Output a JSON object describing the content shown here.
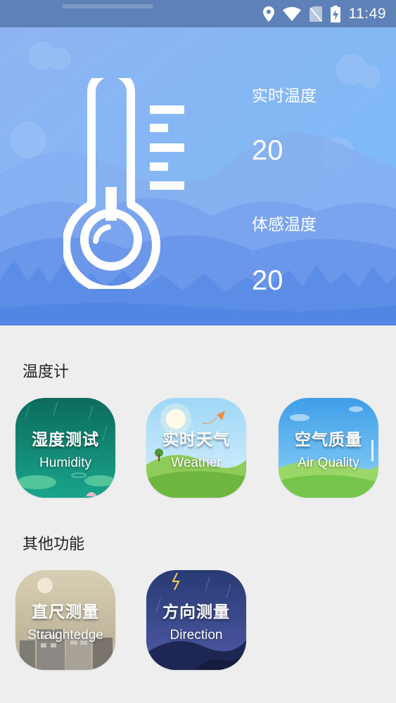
{
  "status_bar": {
    "time": "11:49",
    "icons": [
      "location-icon",
      "wifi-icon",
      "no-sim-icon",
      "battery-charging-icon"
    ]
  },
  "hero": {
    "realtime_temp_label": "实时温度",
    "realtime_temp_value": "20",
    "feels_like_label": "体感温度",
    "feels_like_value": "20"
  },
  "sections": {
    "thermometer_title": "温度计",
    "other_title": "其他功能"
  },
  "tiles": {
    "humidity": {
      "cn": "湿度测试",
      "en": "Humidity"
    },
    "weather": {
      "cn": "实时天气",
      "en": "Weather"
    },
    "air_quality": {
      "cn": "空气质量",
      "en": "Air Quality"
    },
    "ruler": {
      "cn": "直尺测量",
      "en": "Straightedge"
    },
    "direction": {
      "cn": "方向测量",
      "en": "Direction"
    }
  },
  "colors": {
    "hero_sky_top": "#8ab7f3",
    "hero_mountains": "#5b8ce6",
    "page_background": "#eeeeee"
  }
}
